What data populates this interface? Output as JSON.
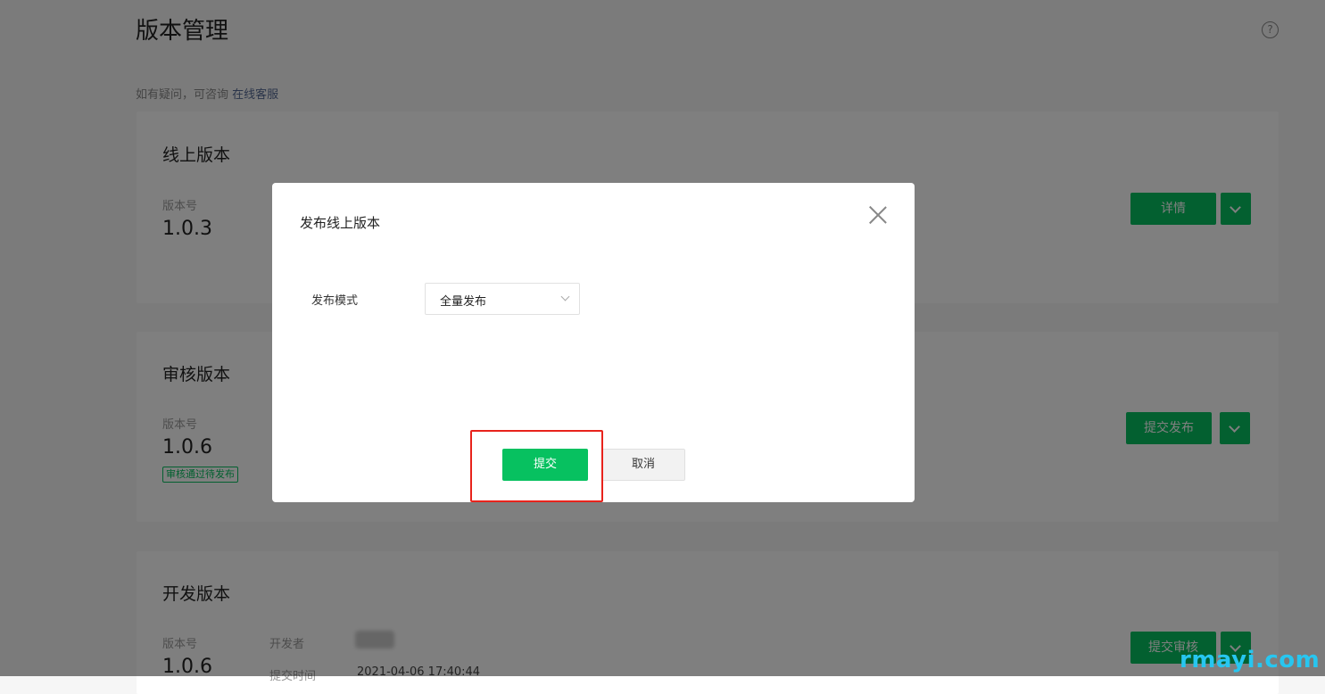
{
  "page": {
    "title": "版本管理",
    "help_prefix": "如有疑问，可咨询 ",
    "help_link": "在线客服",
    "help_icon": "?"
  },
  "cards": {
    "online": {
      "title": "线上版本",
      "version_label": "版本号",
      "version": "1.0.3",
      "button": "详情"
    },
    "review": {
      "title": "审核版本",
      "version_label": "版本号",
      "version": "1.0.6",
      "status_tag": "审核通过待发布",
      "button": "提交发布"
    },
    "dev": {
      "title": "开发版本",
      "version_label": "版本号",
      "version": "1.0.6",
      "developer_label": "开发者",
      "submit_time_label": "提交时间",
      "submit_time": "2021-04-06 17:40:44",
      "button": "提交审核"
    }
  },
  "dialog": {
    "title": "发布线上版本",
    "form_label": "发布模式",
    "select_value": "全量发布",
    "submit_label": "提交",
    "cancel_label": "取消"
  },
  "watermark": "rmayi.com",
  "colors": {
    "primary": "#07c160",
    "highlight": "#e8231c",
    "link": "#576b95",
    "watermark": "#27c6f0"
  }
}
